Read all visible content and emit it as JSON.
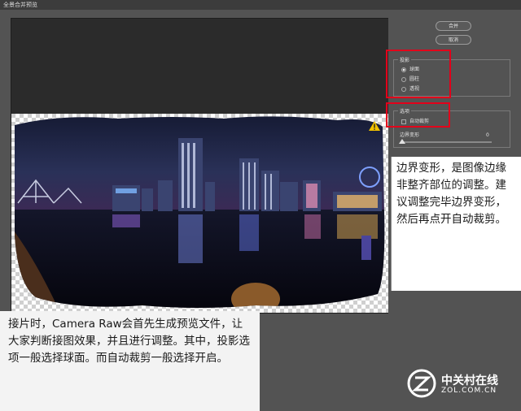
{
  "window": {
    "title": "全景合并预览"
  },
  "buttons": {
    "merge": "合并",
    "cancel": "取消"
  },
  "projection": {
    "label": "投影",
    "options": [
      "球面",
      "圆柱",
      "透视"
    ],
    "selected": "球面"
  },
  "options_group": {
    "label": "选项",
    "auto_crop": {
      "label": "自动裁剪",
      "checked": false
    },
    "boundary_warp": {
      "label": "边界变形",
      "value": "0"
    }
  },
  "annotations": {
    "right": "边界变形，是图像边缘非整齐部位的调整。建议调整完毕边界变形，然后再点开自动裁剪。",
    "bottom_left": "接片时，Camera Raw会首先生成预览文件，让大家判断接图效果，并且进行调整。其中，投影选项一般选择球面。而自动裁剪一般选择开启。"
  },
  "watermark": {
    "brand": "中关村在线",
    "site": "ZOL.COM.CN"
  },
  "colors": {
    "highlight": "#e3001a",
    "panel": "#535353",
    "preview_bg": "#2b2b2b"
  }
}
